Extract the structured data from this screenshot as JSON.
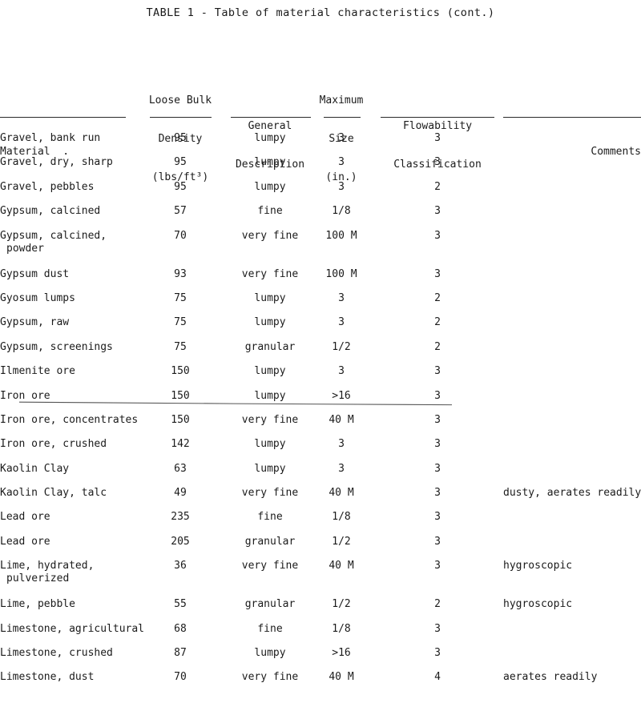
{
  "document": {
    "title": "TABLE 1 - Table of material characteristics (cont.)"
  },
  "table": {
    "columns": [
      {
        "key": "material",
        "label_lines": [
          "",
          "",
          "Material  ."
        ]
      },
      {
        "key": "density",
        "label_lines": [
          "Loose Bulk",
          "Density",
          "(lbs/ft³)"
        ]
      },
      {
        "key": "descr",
        "label_lines": [
          "",
          "General",
          "Description"
        ]
      },
      {
        "key": "size",
        "label_lines": [
          "Maximum",
          "Size",
          "(in.)"
        ]
      },
      {
        "key": "flow",
        "label_lines": [
          "",
          "Flowability",
          "Classification"
        ]
      },
      {
        "key": "comments",
        "label_lines": [
          "",
          "",
          "Comments"
        ]
      }
    ],
    "rows": [
      {
        "material": "Gravel, bank run",
        "material2": "",
        "density": "95",
        "descr": "lumpy",
        "size": "3",
        "flow": "3",
        "comments": "",
        "struck": false
      },
      {
        "material": "Gravel, dry, sharp",
        "material2": "",
        "density": "95",
        "descr": "lumpy",
        "size": "3",
        "flow": "3",
        "comments": "",
        "struck": false
      },
      {
        "material": "Gravel, pebbles",
        "material2": "",
        "density": "95",
        "descr": "lumpy",
        "size": "3",
        "flow": "2",
        "comments": "",
        "struck": false
      },
      {
        "material": "Gypsum, calcined",
        "material2": "",
        "density": "57",
        "descr": "fine",
        "size": "1/8",
        "flow": "3",
        "comments": "",
        "struck": false
      },
      {
        "material": "Gypsum, calcined,",
        "material2": "powder",
        "density": "70",
        "descr": "very fine",
        "size": "100 M",
        "flow": "3",
        "comments": "",
        "struck": false
      },
      {
        "material": "Gypsum dust",
        "material2": "",
        "density": "93",
        "descr": "very fine",
        "size": "100 M",
        "flow": "3",
        "comments": "",
        "struck": false
      },
      {
        "material": "Gyosum lumps",
        "material2": "",
        "density": "75",
        "descr": "lumpy",
        "size": "3",
        "flow": "2",
        "comments": "",
        "struck": false
      },
      {
        "material": "Gypsum, raw",
        "material2": "",
        "density": "75",
        "descr": "lumpy",
        "size": "3",
        "flow": "2",
        "comments": "",
        "struck": false
      },
      {
        "material": "Gypsum, screenings",
        "material2": "",
        "density": "75",
        "descr": "granular",
        "size": "1/2",
        "flow": "2",
        "comments": "",
        "struck": false
      },
      {
        "material": "Ilmenite ore",
        "material2": "",
        "density": "150",
        "descr": "lumpy",
        "size": "3",
        "flow": "3",
        "comments": "",
        "struck": false
      },
      {
        "material": "Iron ore",
        "material2": "",
        "density": "150",
        "descr": "lumpy",
        "size": ">16",
        "flow": "3",
        "comments": "",
        "struck": true
      },
      {
        "material": "Iron ore, concentrates",
        "material2": "",
        "density": "150",
        "descr": "very fine",
        "size": "40 M",
        "flow": "3",
        "comments": "",
        "struck": false
      },
      {
        "material": "Iron ore, crushed",
        "material2": "",
        "density": "142",
        "descr": "lumpy",
        "size": "3",
        "flow": "3",
        "comments": "",
        "struck": false
      },
      {
        "material": "Kaolin Clay",
        "material2": "",
        "density": "63",
        "descr": "lumpy",
        "size": "3",
        "flow": "3",
        "comments": "",
        "struck": false
      },
      {
        "material": "Kaolin Clay, talc",
        "material2": "",
        "density": "49",
        "descr": "very fine",
        "size": "40 M",
        "flow": "3",
        "comments": "dusty, aerates readily",
        "struck": false
      },
      {
        "material": "Lead ore",
        "material2": "",
        "density": "235",
        "descr": "fine",
        "size": "1/8",
        "flow": "3",
        "comments": "",
        "struck": false
      },
      {
        "material": "Lead ore",
        "material2": "",
        "density": "205",
        "descr": "granular",
        "size": "1/2",
        "flow": "3",
        "comments": "",
        "struck": false
      },
      {
        "material": "Lime, hydrated,",
        "material2": "pulverized",
        "density": "36",
        "descr": "very fine",
        "size": "40 M",
        "flow": "3",
        "comments": "hygroscopic",
        "struck": false
      },
      {
        "material": "Lime, pebble",
        "material2": "",
        "density": "55",
        "descr": "granular",
        "size": "1/2",
        "flow": "2",
        "comments": "hygroscopic",
        "struck": false
      },
      {
        "material": "Limestone, agricultural",
        "material2": "",
        "density": "68",
        "descr": "fine",
        "size": "1/8",
        "flow": "3",
        "comments": "",
        "struck": false
      },
      {
        "material": "Limestone, crushed",
        "material2": "",
        "density": "87",
        "descr": "lumpy",
        "size": ">16",
        "flow": "3",
        "comments": "",
        "struck": false
      },
      {
        "material": "Limestone, dust",
        "material2": "",
        "density": "70",
        "descr": "very fine",
        "size": "40 M",
        "flow": "4",
        "comments": "aerates readily",
        "struck": false
      }
    ]
  },
  "colors": {
    "ink": "#1b1b1b",
    "rule": "#2a2a2a",
    "paper": "#ffffff",
    "annotation": "#555555"
  }
}
